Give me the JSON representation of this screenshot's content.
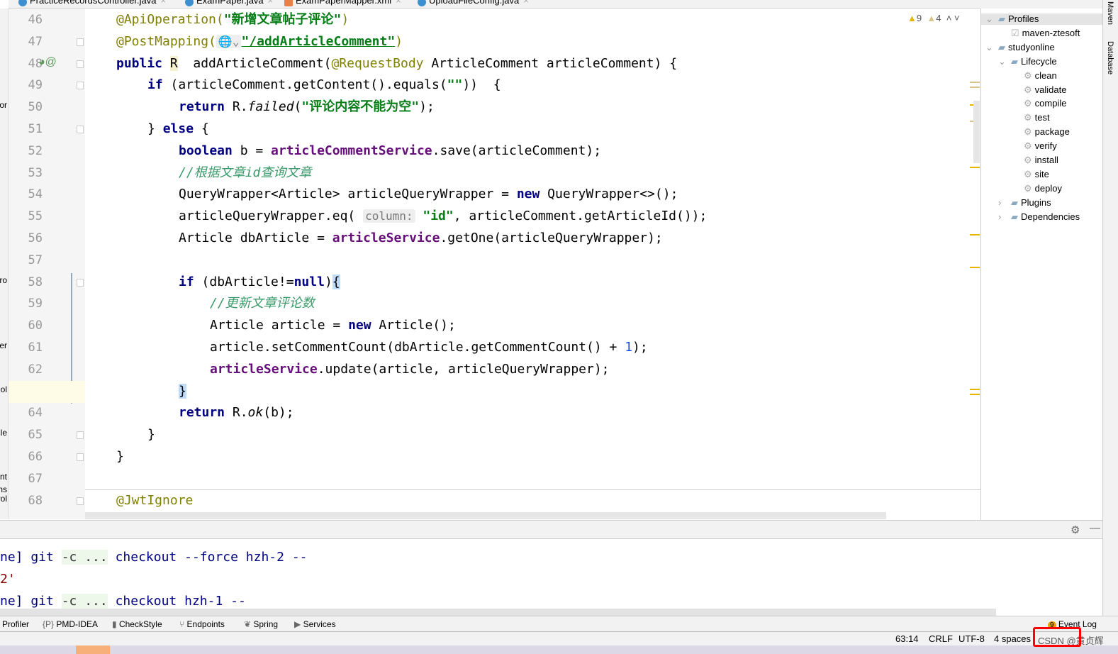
{
  "tabs": [
    {
      "label": "PracticeRecordsController.java",
      "type": "java"
    },
    {
      "label": "ExamPaper.java",
      "type": "java"
    },
    {
      "label": "ExamPaperMapper.xml",
      "type": "xml"
    },
    {
      "label": "UploadFileConfig.java",
      "type": "java"
    }
  ],
  "left_fragments": [
    {
      "text": "or",
      "line": 50
    },
    {
      "text": "ro",
      "line": 58
    },
    {
      "text": "er",
      "line": 61
    },
    {
      "text": "ol",
      "line": 63
    },
    {
      "text": "olle",
      "line": 65
    },
    {
      "text": "nt",
      "line": 67
    },
    {
      "text": "ns",
      "line": 67.6
    },
    {
      "text": "rol",
      "line": 68
    }
  ],
  "inspections": {
    "warnings": "9",
    "weak_warnings": "4"
  },
  "code": [
    {
      "n": "46",
      "indent": 0,
      "t": [
        [
          "an",
          "@ApiOperation("
        ],
        [
          "st",
          "\"新增文章帖子评论\""
        ],
        [
          "an",
          ")"
        ]
      ]
    },
    {
      "n": "47",
      "indent": 0,
      "t": [
        [
          "an",
          "@PostMapping("
        ],
        [
          "hint",
          "🌐⌄"
        ],
        [
          "st und",
          "\"/addArticleComment\""
        ],
        [
          "an",
          ")"
        ]
      ]
    },
    {
      "n": "48",
      "indent": 0,
      "t": [
        [
          "kw",
          "public "
        ],
        [
          "rh",
          "R"
        ],
        [
          "",
          "  addArticleComment("
        ],
        [
          "an",
          "@RequestBody"
        ],
        [
          "",
          " ArticleComment articleComment) {"
        ]
      ]
    },
    {
      "n": "49",
      "indent": 1,
      "t": [
        [
          "kw",
          "if"
        ],
        [
          "",
          " (articleComment.getContent().equals("
        ],
        [
          "st",
          "\"\""
        ],
        [
          "",
          "))  {"
        ]
      ]
    },
    {
      "n": "50",
      "indent": 2,
      "t": [
        [
          "kw",
          "return"
        ],
        [
          "",
          " R."
        ],
        [
          "it",
          "failed"
        ],
        [
          "",
          "("
        ],
        [
          "st",
          "\"评论内容不能为空\""
        ],
        [
          "",
          ");"
        ]
      ]
    },
    {
      "n": "51",
      "indent": 1,
      "t": [
        [
          "",
          "} "
        ],
        [
          "kw",
          "else"
        ],
        [
          "",
          " {"
        ]
      ]
    },
    {
      "n": "52",
      "indent": 2,
      "t": [
        [
          "kw",
          "boolean"
        ],
        [
          "",
          " b = "
        ],
        [
          "fld",
          "articleCommentService"
        ],
        [
          "",
          ".save(articleComment);"
        ]
      ]
    },
    {
      "n": "53",
      "indent": 2,
      "t": [
        [
          "cm",
          "//根据文章id查询文章"
        ]
      ]
    },
    {
      "n": "54",
      "indent": 2,
      "t": [
        [
          "",
          "QueryWrapper<Article> articleQueryWrapper = "
        ],
        [
          "kw",
          "new"
        ],
        [
          "",
          " QueryWrapper<>();"
        ]
      ]
    },
    {
      "n": "55",
      "indent": 2,
      "t": [
        [
          "",
          "articleQueryWrapper.eq( "
        ],
        [
          "hint",
          "column:"
        ],
        [
          "st",
          " \"id\""
        ],
        [
          "",
          ", articleComment.getArticleId());"
        ]
      ]
    },
    {
      "n": "56",
      "indent": 2,
      "t": [
        [
          "",
          "Article dbArticle = "
        ],
        [
          "fld",
          "articleService"
        ],
        [
          "",
          ".getOne(articleQueryWrapper);"
        ]
      ]
    },
    {
      "n": "57",
      "indent": 0,
      "t": []
    },
    {
      "n": "58",
      "indent": 2,
      "t": [
        [
          "kw",
          "if"
        ],
        [
          "",
          " (dbArticle!="
        ],
        [
          "kw",
          "null"
        ],
        [
          "",
          ")"
        ],
        [
          "hl",
          "{"
        ]
      ]
    },
    {
      "n": "59",
      "indent": 3,
      "t": [
        [
          "cm",
          "//更新文章评论数"
        ]
      ]
    },
    {
      "n": "60",
      "indent": 3,
      "t": [
        [
          "",
          "Article article = "
        ],
        [
          "kw",
          "new"
        ],
        [
          "",
          " Article();"
        ]
      ]
    },
    {
      "n": "61",
      "indent": 3,
      "t": [
        [
          "",
          "article.setCommentCount(dbArticle.getCommentCount() + "
        ],
        [
          "num",
          "1"
        ],
        [
          "",
          ");"
        ]
      ]
    },
    {
      "n": "62",
      "indent": 3,
      "t": [
        [
          "fld",
          "articleService"
        ],
        [
          "",
          ".update(article, articleQueryWrapper);"
        ]
      ]
    },
    {
      "n": "63",
      "indent": 2,
      "t": [
        [
          "hl",
          "}"
        ]
      ]
    },
    {
      "n": "64",
      "indent": 2,
      "t": [
        [
          "kw",
          "return"
        ],
        [
          "",
          " R."
        ],
        [
          "it",
          "ok"
        ],
        [
          "",
          "(b);"
        ]
      ]
    },
    {
      "n": "65",
      "indent": 1,
      "t": [
        [
          "",
          "}"
        ]
      ]
    },
    {
      "n": "66",
      "indent": 0,
      "t": [
        [
          "",
          "}"
        ]
      ]
    },
    {
      "n": "67",
      "indent": 0,
      "t": []
    },
    {
      "n": "68",
      "indent": 0,
      "t": [
        [
          "an",
          "@JwtIgnore"
        ]
      ]
    }
  ],
  "maven": {
    "items": [
      {
        "label": "Profiles",
        "level": 0,
        "arrow": "⌄",
        "icon": "profiles-folder-icon",
        "selected": true
      },
      {
        "label": "maven-ztesoft",
        "level": 1,
        "icon": "checkbox-icon",
        "checked": true
      },
      {
        "label": "studyonline",
        "level": 0,
        "arrow": "⌄",
        "icon": "maven-project-icon"
      },
      {
        "label": "Lifecycle",
        "level": 1,
        "arrow": "⌄",
        "icon": "lifecycle-folder-icon"
      },
      {
        "label": "clean",
        "level": 2,
        "icon": "gear-icon"
      },
      {
        "label": "validate",
        "level": 2,
        "icon": "gear-icon"
      },
      {
        "label": "compile",
        "level": 2,
        "icon": "gear-icon"
      },
      {
        "label": "test",
        "level": 2,
        "icon": "gear-icon"
      },
      {
        "label": "package",
        "level": 2,
        "icon": "gear-icon"
      },
      {
        "label": "verify",
        "level": 2,
        "icon": "gear-icon"
      },
      {
        "label": "install",
        "level": 2,
        "icon": "gear-icon"
      },
      {
        "label": "site",
        "level": 2,
        "icon": "gear-icon"
      },
      {
        "label": "deploy",
        "level": 2,
        "icon": "gear-icon"
      },
      {
        "label": "Plugins",
        "level": 1,
        "arrow": "›",
        "icon": "plugins-folder-icon"
      },
      {
        "label": "Dependencies",
        "level": 1,
        "arrow": "›",
        "icon": "dependencies-folder-icon"
      }
    ]
  },
  "right_strip": {
    "maven": "Maven",
    "database": "Database"
  },
  "console": [
    [
      [
        "",
        "ne] git "
      ],
      [
        "cg",
        "-c ..."
      ],
      [
        "",
        " checkout --force hzh-2 --"
      ]
    ],
    [
      [
        "red",
        "2'"
      ]
    ],
    [
      [
        "",
        "ne] git "
      ],
      [
        "cg",
        "-c ..."
      ],
      [
        "",
        " checkout hzh-1 --"
      ]
    ]
  ],
  "tool_windows": [
    {
      "label": "Profiler",
      "icon": ""
    },
    {
      "label": "PMD-IDEA",
      "icon": "{P}"
    },
    {
      "label": "CheckStyle",
      "icon": "▮"
    },
    {
      "label": "Endpoints",
      "icon": "⑂"
    },
    {
      "label": "Spring",
      "icon": "❦"
    },
    {
      "label": "Services",
      "icon": "▶"
    }
  ],
  "event_log": {
    "label": "Event Log",
    "count": "9"
  },
  "status": {
    "position": "63:14",
    "line_sep": "CRLF",
    "encoding": "UTF-8",
    "indent": "4 spaces",
    "watermark": "CSDN @黄贞辉"
  },
  "colors": {
    "accent": "#3c8fd0",
    "highlight_box": "#ff0000",
    "warning": "#e8b400"
  }
}
